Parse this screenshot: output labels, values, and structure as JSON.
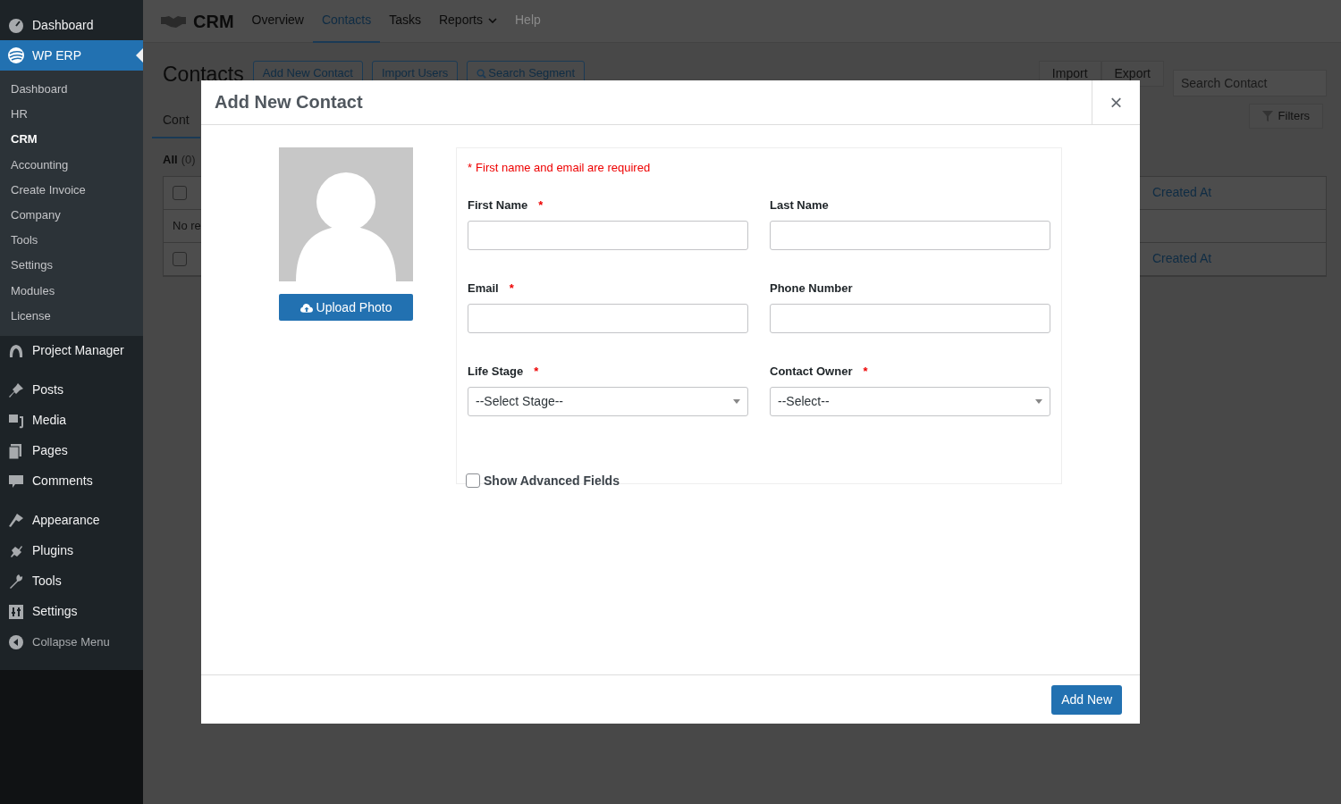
{
  "sidebar": {
    "top_items": [
      {
        "label": "Dashboard",
        "selected": false
      },
      {
        "label": "WP ERP",
        "selected": true
      }
    ],
    "submenu": [
      {
        "label": "Dashboard",
        "selected": false
      },
      {
        "label": "HR",
        "selected": false
      },
      {
        "label": "CRM",
        "selected": true
      },
      {
        "label": "Accounting",
        "selected": false
      },
      {
        "label": "Create Invoice",
        "selected": false
      },
      {
        "label": "Company",
        "selected": false
      },
      {
        "label": "Tools",
        "selected": false
      },
      {
        "label": "Settings",
        "selected": false
      },
      {
        "label": "Modules",
        "selected": false
      },
      {
        "label": "License",
        "selected": false
      }
    ],
    "menu_groups": [
      [
        {
          "label": "Project Manager"
        }
      ],
      [
        {
          "label": "Posts"
        },
        {
          "label": "Media"
        },
        {
          "label": "Pages"
        },
        {
          "label": "Comments"
        }
      ],
      [
        {
          "label": "Appearance"
        },
        {
          "label": "Plugins"
        },
        {
          "label": "Tools"
        },
        {
          "label": "Settings"
        },
        {
          "label": "Collapse Menu"
        }
      ]
    ]
  },
  "topbar": {
    "brand": "CRM",
    "nav": [
      {
        "label": "Overview",
        "selected": false,
        "disabled": false,
        "dropdown": false
      },
      {
        "label": "Contacts",
        "selected": true,
        "disabled": false,
        "dropdown": false
      },
      {
        "label": "Tasks",
        "selected": false,
        "disabled": false,
        "dropdown": false
      },
      {
        "label": "Reports",
        "selected": false,
        "disabled": false,
        "dropdown": true
      },
      {
        "label": "Help",
        "selected": false,
        "disabled": true,
        "dropdown": false
      }
    ]
  },
  "page": {
    "title": "Contacts",
    "buttons": [
      {
        "label": "Add New Contact",
        "kind": "plain"
      },
      {
        "label": "Import Users",
        "kind": "plain"
      },
      {
        "label": "Search Segment",
        "kind": "search"
      }
    ],
    "right_buttons": [
      "Import",
      "Export"
    ],
    "search": {
      "placeholder": "Search Contact"
    },
    "filters": "Filters",
    "tab": "Cont",
    "filter_all": "All",
    "filter_count": "(0)",
    "rows": [
      {
        "kind": "header",
        "checked": false,
        "column": "Created At"
      },
      {
        "kind": "empty",
        "text": "No re"
      },
      {
        "kind": "header",
        "checked": false,
        "column": "Created At"
      }
    ]
  },
  "modal": {
    "title": "Add New Contact",
    "close": "×",
    "required_note": "First name and email are required",
    "required_mark": "*",
    "upload": "Upload Photo",
    "fields": [
      {
        "label": "First Name",
        "required": true,
        "kind": "text"
      },
      {
        "label": "Last Name",
        "required": false,
        "kind": "text"
      },
      {
        "label": "Email",
        "required": true,
        "kind": "text"
      },
      {
        "label": "Phone Number",
        "required": false,
        "kind": "text"
      },
      {
        "label": "Life Stage",
        "required": true,
        "kind": "select",
        "value": "--Select Stage--"
      },
      {
        "label": "Contact Owner",
        "required": true,
        "kind": "select",
        "value": "--Select--"
      }
    ],
    "advanced": {
      "label": "Show Advanced Fields",
      "checked": false
    },
    "submit": "Add New"
  }
}
